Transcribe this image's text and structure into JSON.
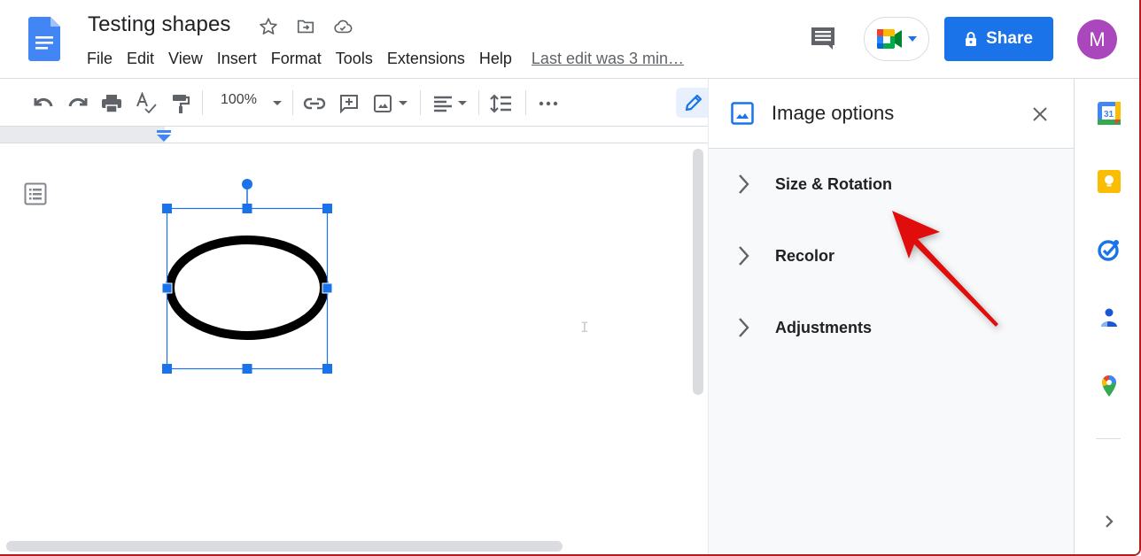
{
  "header": {
    "doc_title": "Testing shapes",
    "menu": [
      "File",
      "Edit",
      "View",
      "Insert",
      "Format",
      "Tools",
      "Extensions",
      "Help"
    ],
    "last_edit": "Last edit was 3 min…",
    "share_label": "Share",
    "avatar_initial": "M"
  },
  "toolbar": {
    "zoom": "100%"
  },
  "panel": {
    "title": "Image options",
    "sections": [
      "Size & Rotation",
      "Recolor",
      "Adjustments"
    ]
  },
  "colors": {
    "accent": "#1a73e8",
    "avatar": "#ab47bc",
    "annotation_arrow": "#e01010"
  }
}
